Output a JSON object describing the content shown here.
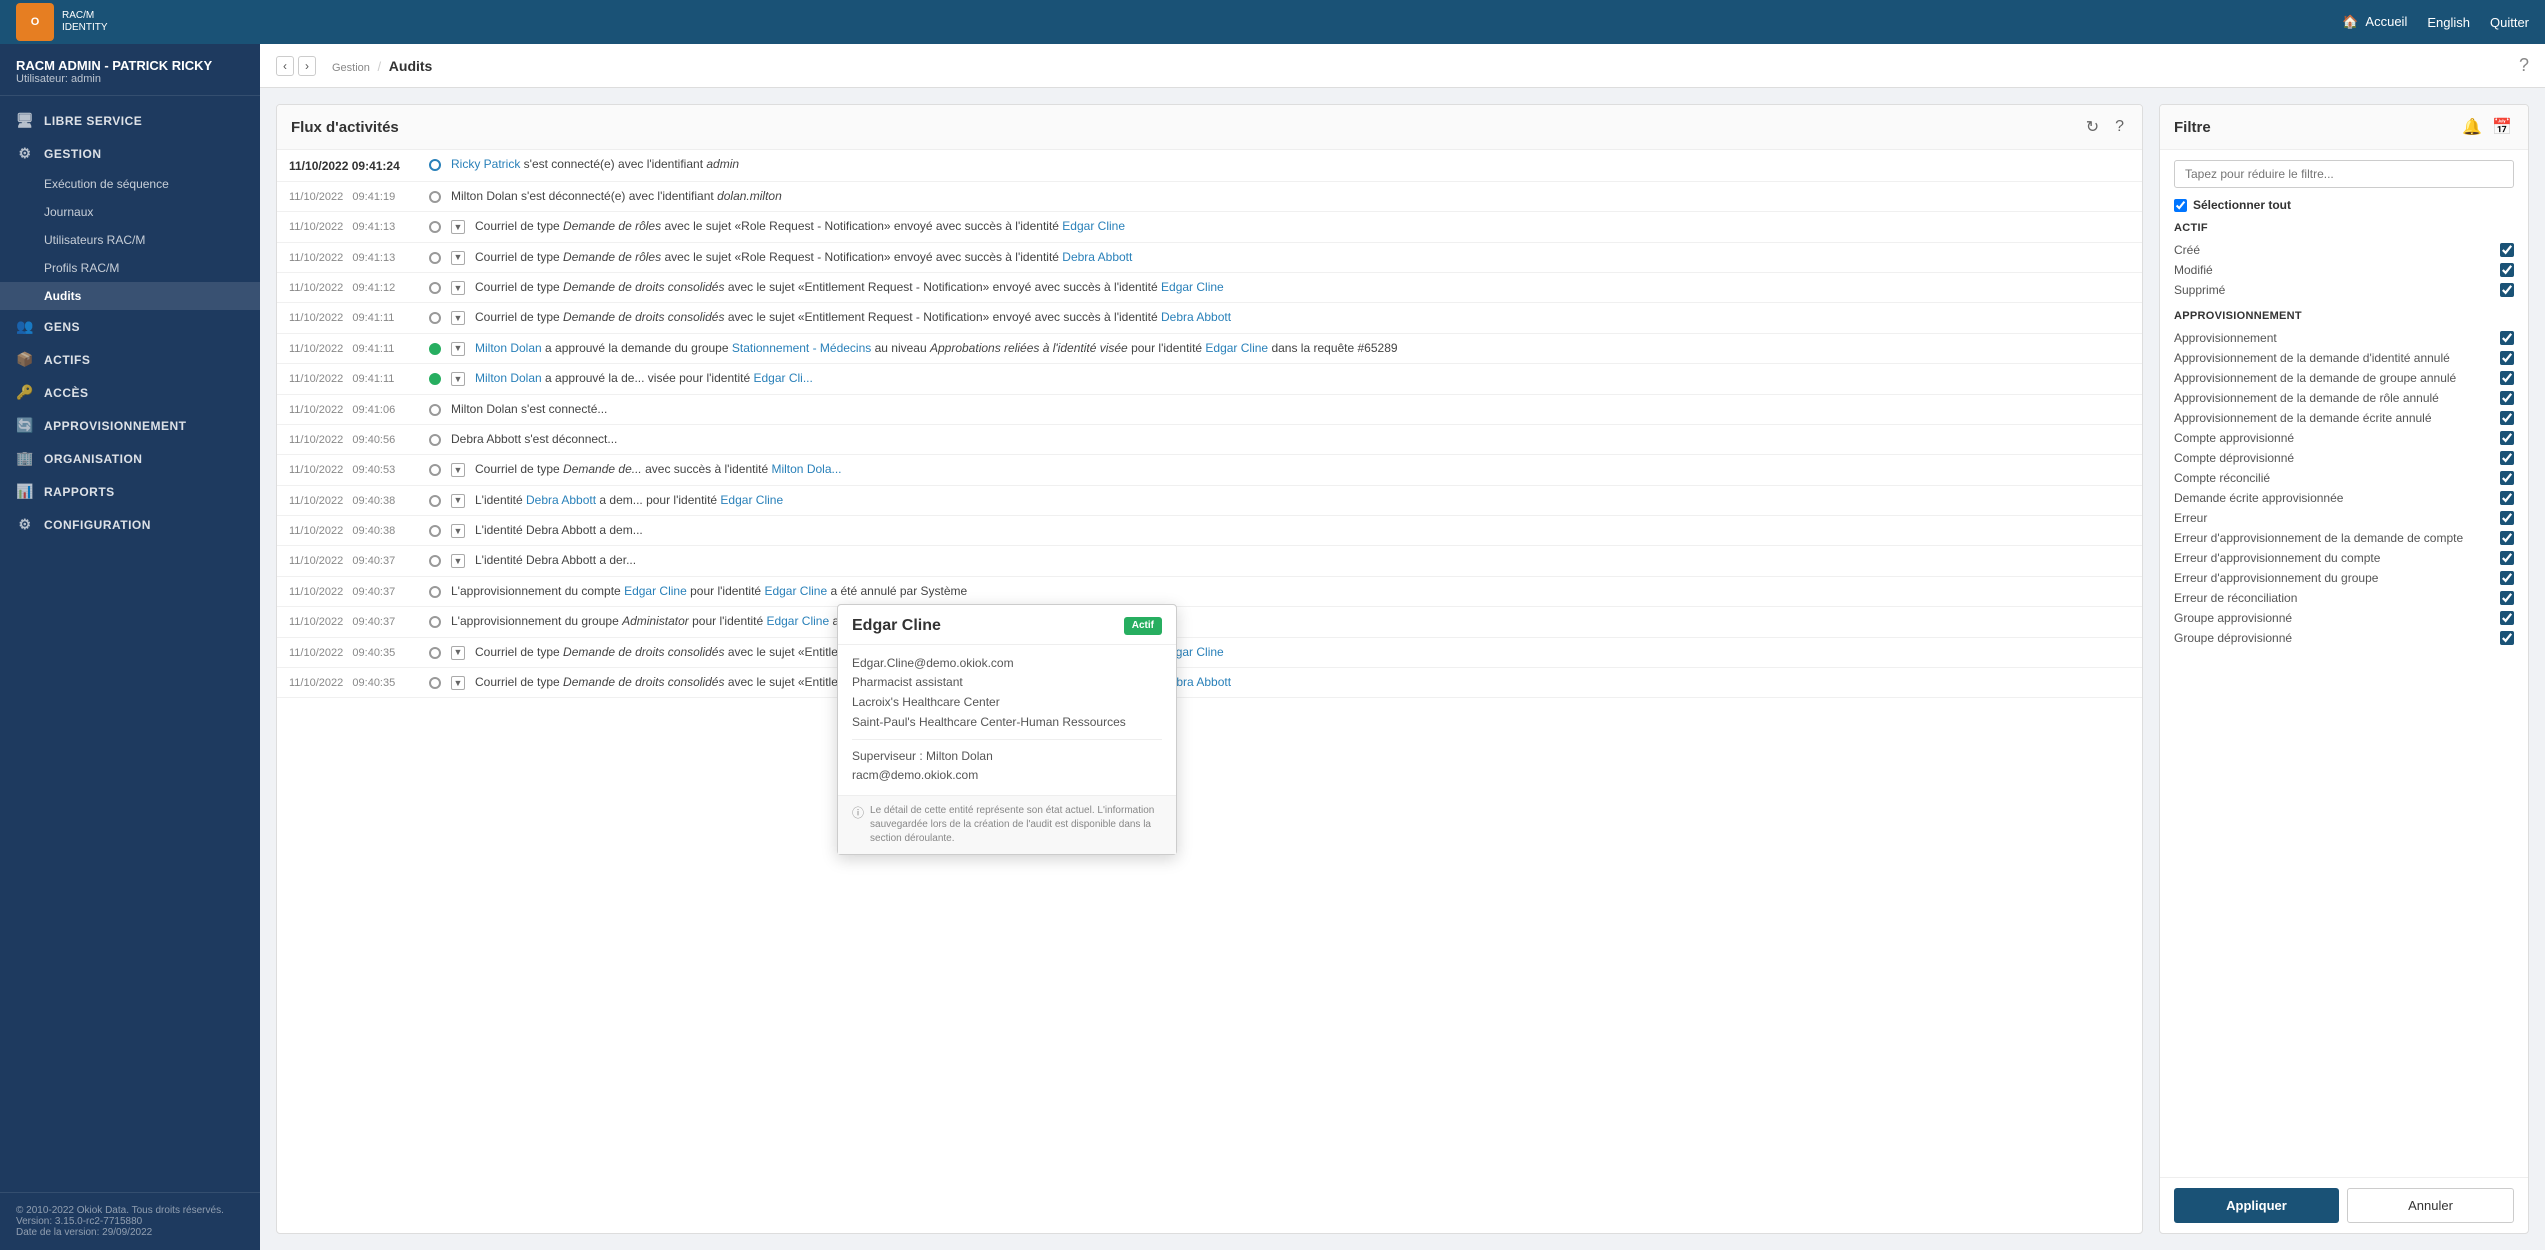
{
  "topNav": {
    "logoLine1": "RAC/M",
    "logoLine2": "IDENTITY",
    "logoLetter": "O",
    "homeLabel": "Accueil",
    "langLabel": "English",
    "quitLabel": "Quitter"
  },
  "sidebar": {
    "userName": "RACM ADMIN - PATRICK RICKY",
    "userRole": "Utilisateur: admin",
    "sections": [
      {
        "id": "libre-service",
        "icon": "🖥",
        "label": "LIBRE SERVICE"
      },
      {
        "id": "gestion",
        "icon": "⚙",
        "label": "GESTION"
      }
    ],
    "gestionSubItems": [
      {
        "id": "execution",
        "label": "Exécution de séquence"
      },
      {
        "id": "journaux",
        "label": "Journaux"
      },
      {
        "id": "utilisateurs",
        "label": "Utilisateurs RAC/M"
      },
      {
        "id": "profils",
        "label": "Profils RAC/M"
      },
      {
        "id": "audits",
        "label": "Audits",
        "active": true
      }
    ],
    "mainMenuItems": [
      {
        "id": "gens",
        "icon": "👥",
        "label": "GENS"
      },
      {
        "id": "actifs",
        "icon": "📦",
        "label": "ACTIFS"
      },
      {
        "id": "acces",
        "icon": "🔑",
        "label": "ACCÈS"
      },
      {
        "id": "approvisionnement",
        "icon": "🔄",
        "label": "APPROVISIONNEMENT"
      },
      {
        "id": "organisation",
        "icon": "🏢",
        "label": "ORGANISATION"
      },
      {
        "id": "rapports",
        "icon": "📊",
        "label": "RAPPORTS"
      },
      {
        "id": "configuration",
        "icon": "⚙",
        "label": "CONFIGURATION"
      }
    ],
    "footer": {
      "copyright": "© 2010-2022 Okiok Data. Tous droits réservés.",
      "version": "Version: 3.15.0-rc2-7715880",
      "date": "Date de la version: 29/09/2022"
    }
  },
  "breadcrumb": {
    "section": "Gestion",
    "page": "Audits"
  },
  "activityPanel": {
    "title": "Flux d'activités",
    "items": [
      {
        "time": "11/10/2022 09:41:24",
        "mainTime": true,
        "dot": "blue",
        "expandable": false,
        "text": " s'est connecté(e) avec l'identifiant ",
        "links": [
          {
            "text": "Ricky Patrick",
            "pos": "before"
          }
        ],
        "italic": "admin"
      },
      {
        "time": "11/10/2022   09:41:19",
        "dot": "blue",
        "expandable": false,
        "text": "Milton Dolan s'est déconnecté(e) avec l'identifiant ",
        "italic": "dolan.milton"
      },
      {
        "time": "11/10/2022   09:41:13",
        "dot": "blue",
        "expandable": true,
        "text": "Courriel de type Demande de rôles avec le sujet «Role Request - Notification» envoyé avec succès à l'identité ",
        "linkText": "Edgar Cline"
      },
      {
        "time": "11/10/2022   09:41:13",
        "dot": "blue",
        "expandable": true,
        "text": "Courriel de type Demande de rôles avec le sujet «Role Request - Notification» envoyé avec succès à l'identité ",
        "linkText": "Debra Abbott"
      },
      {
        "time": "11/10/2022   09:41:12",
        "dot": "blue",
        "expandable": true,
        "text": "Courriel de type Demande de droits consolidés avec le sujet «Entitlement Request - Notification» envoyé avec succès à l'identité ",
        "linkText": "Edgar Cline"
      },
      {
        "time": "11/10/2022   09:41:11",
        "dot": "blue",
        "expandable": true,
        "text": "Courriel de type Demande de droits consolidés avec le sujet «Entitlement Request - Notification» envoyé avec succès à l'identité ",
        "linkText": "Debra Abbott"
      },
      {
        "time": "11/10/2022   09:41:11",
        "dot": "green",
        "expandable": true,
        "text": " a approuvé la demande du groupe  au niveau Approbations reliées à l'identité visée pour l'identité  dans la requête #65289",
        "links": [
          "Milton Dolan",
          "Stationnement - Médecins",
          "Edgar Cline"
        ]
      },
      {
        "time": "11/10/2022   09:41:11",
        "dot": "green",
        "expandable": true,
        "text": " a approuvé la de...",
        "truncated": true
      },
      {
        "time": "11/10/2022   09:41:06",
        "dot": "blue",
        "expandable": false,
        "text": "Milton Dolan s'est connecté..."
      },
      {
        "time": "11/10/2022   09:40:56",
        "dot": "blue",
        "expandable": false,
        "text": "Debra Abbott s'est déconnect..."
      },
      {
        "time": "11/10/2022   09:40:53",
        "dot": "blue",
        "expandable": true,
        "text": "Courriel de type Demande de... avec succès à l'identité ",
        "linkText": "Milton Dola..."
      },
      {
        "time": "11/10/2022   09:40:38",
        "dot": "blue",
        "expandable": true,
        "text": "L'identité  a dem... pour l'identité ",
        "links": [
          "Debra Abbott",
          "Edgar Cline"
        ]
      },
      {
        "time": "11/10/2022   09:40:38",
        "dot": "blue",
        "expandable": true,
        "text": "L'identité Debra Abbott a dem..."
      },
      {
        "time": "11/10/2022   09:40:37",
        "dot": "blue",
        "expandable": true,
        "text": "L'identité Debra Abbott a der..."
      },
      {
        "time": "11/10/2022   09:40:37",
        "dot": "blue",
        "expandable": false,
        "text": "L'approvisionnement du compte  pour l'identité  a été annulé par Système",
        "links": [
          "Edgar Cline",
          "Edgar Cline"
        ]
      },
      {
        "time": "11/10/2022   09:40:37",
        "dot": "blue",
        "expandable": false,
        "text": "L'approvisionnement du groupe Administator pour l'identité  a été annulé par Système",
        "links": [
          "Edgar Cline"
        ]
      },
      {
        "time": "11/10/2022   09:40:35",
        "dot": "blue",
        "expandable": true,
        "text": "Courriel de type Demande de droits consolidés avec le sujet «Entitlement Request - Notification» envoyé avec succès à l'identité ",
        "linkText": "Edgar Cline"
      },
      {
        "time": "11/10/2022   09:40:35",
        "dot": "blue",
        "expandable": true,
        "text": "Courriel de type Demande de droits consolidés avec le sujet «Entitlement Request - Notification» envoyé avec succès à l'identité ",
        "linkText": "Debra Abbott"
      }
    ]
  },
  "tooltip": {
    "name": "Edgar Cline",
    "status": "Actif",
    "email": "Edgar.Cline@demo.okiok.com",
    "role": "Pharmacist assistant",
    "org": "Lacroix's Healthcare Center",
    "dept": "Saint-Paul's Healthcare Center-Human Ressources",
    "supervisorLabel": "Superviseur :",
    "supervisorName": "Milton Dolan",
    "supervisorEmail": "racm@demo.okiok.com",
    "footerNote": "ⓘ Le détail de cette entité représente son état actuel. L'information sauvegardée lors de la création de l'audit est disponible dans la section déroulante."
  },
  "filterPanel": {
    "title": "Filtre",
    "searchPlaceholder": "Tapez pour réduire le filtre...",
    "selectAllLabel": "Sélectionner tout",
    "sections": [
      {
        "title": "ACTIF",
        "items": [
          {
            "label": "Créé",
            "checked": true
          },
          {
            "label": "Modifié",
            "checked": true
          },
          {
            "label": "Supprimé",
            "checked": true
          }
        ]
      },
      {
        "title": "APPROVISIONNEMENT",
        "items": [
          {
            "label": "Approvisionnement",
            "checked": true
          },
          {
            "label": "Approvisionnement de la demande d'identité annulé",
            "checked": true
          },
          {
            "label": "Approvisionnement de la demande de groupe annulé",
            "checked": true
          },
          {
            "label": "Approvisionnement de la demande de rôle annulé",
            "checked": true
          },
          {
            "label": "Approvisionnement de la demande écrite annulé",
            "checked": true
          },
          {
            "label": "Compte approvisionné",
            "checked": true
          },
          {
            "label": "Compte déprovisionné",
            "checked": true
          },
          {
            "label": "Compte réconcilié",
            "checked": true
          },
          {
            "label": "Demande écrite approvisionnée",
            "checked": true
          },
          {
            "label": "Erreur",
            "checked": true
          },
          {
            "label": "Erreur d'approvisionnement de la demande de compte",
            "checked": true
          },
          {
            "label": "Erreur d'approvisionnement du compte",
            "checked": true
          },
          {
            "label": "Erreur d'approvisionnement du groupe",
            "checked": true
          },
          {
            "label": "Erreur de réconciliation",
            "checked": true
          },
          {
            "label": "Groupe approvisionné",
            "checked": true
          },
          {
            "label": "Groupe déprovisionné",
            "checked": true
          }
        ]
      }
    ],
    "applyLabel": "Appliquer",
    "cancelLabel": "Annuler"
  }
}
